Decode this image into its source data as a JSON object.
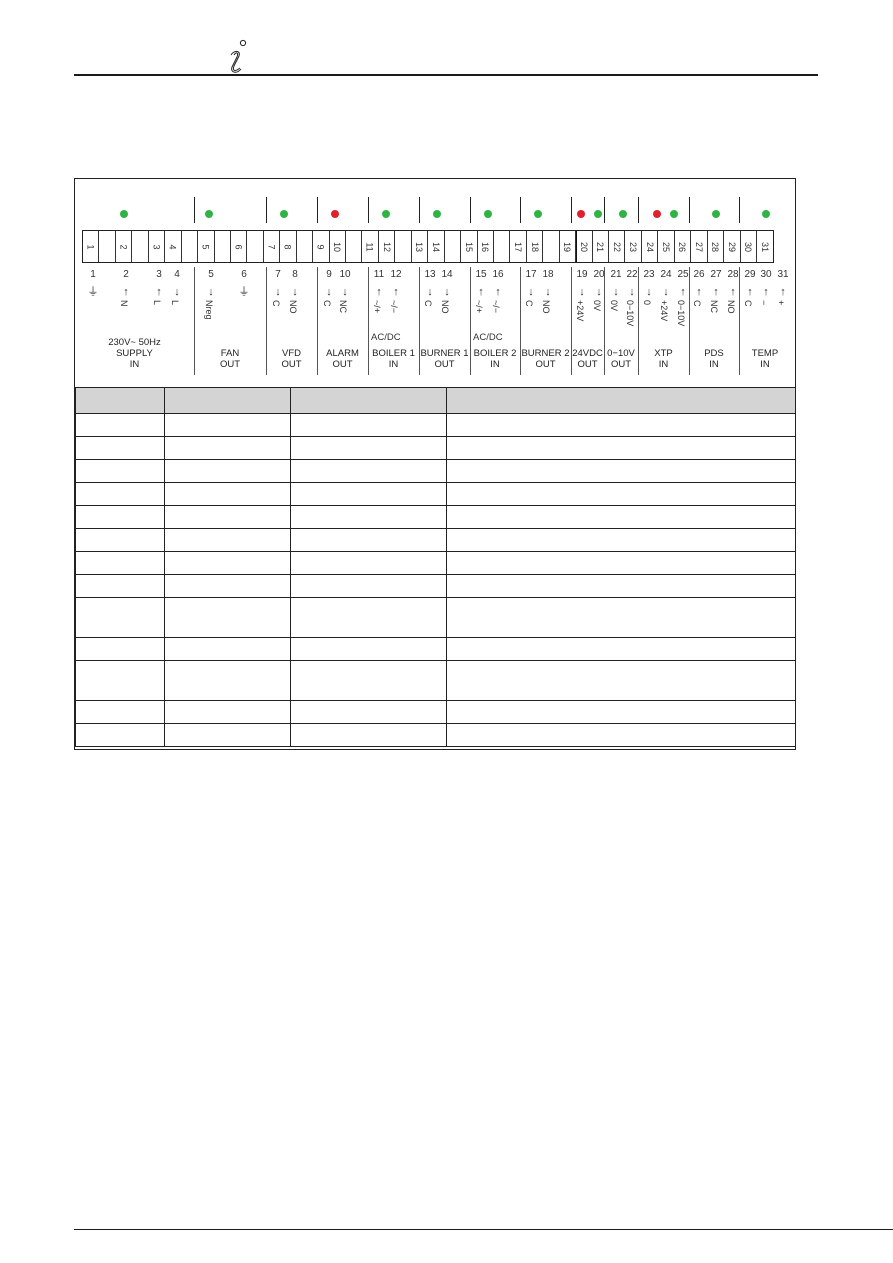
{
  "header": {
    "icon": "info-icon"
  },
  "diagram": {
    "strip_cells": [
      "1",
      "",
      "2",
      "",
      "3",
      "4",
      "",
      "5",
      "",
      "6",
      "",
      "7",
      "8",
      "",
      "9",
      "10",
      "",
      "11",
      "12",
      "",
      "13",
      "14",
      "",
      "15",
      "16",
      "",
      "17",
      "18",
      "",
      "19",
      "20",
      "21",
      "22",
      "23",
      "24",
      "25",
      "26",
      "27",
      "28",
      "29",
      "30",
      "31"
    ],
    "leds": [
      {
        "group": "supply",
        "color": "green"
      },
      {
        "group": "fan",
        "color": "green"
      },
      {
        "group": "vfd",
        "color": "green"
      },
      {
        "group": "alarm",
        "color": "red"
      },
      {
        "group": "boiler1",
        "color": "green"
      },
      {
        "group": "burner1",
        "color": "green"
      },
      {
        "group": "boiler2",
        "color": "green"
      },
      {
        "group": "burner2",
        "color": "green"
      },
      {
        "group": "24vdc",
        "color": "red"
      },
      {
        "group": "24vdc",
        "color": "green"
      },
      {
        "group": "0-10v",
        "color": "green"
      },
      {
        "group": "xtp",
        "color": "red"
      },
      {
        "group": "xtp",
        "color": "green"
      },
      {
        "group": "pds",
        "color": "green"
      },
      {
        "group": "temp",
        "color": "green"
      }
    ],
    "colors": {
      "led_green": "#2fb344",
      "led_red": "#e0202a"
    },
    "terminals": [
      {
        "n": "1",
        "arrow": "⏚",
        "sig": ""
      },
      {
        "n": "2",
        "arrow": "↑",
        "sig": "N"
      },
      {
        "n": "3",
        "arrow": "↑",
        "sig": "L"
      },
      {
        "n": "4",
        "arrow": "↓",
        "sig": "L"
      },
      {
        "n": "5",
        "arrow": "↓",
        "sig": "Nreg"
      },
      {
        "n": "6",
        "arrow": "⏚",
        "sig": ""
      },
      {
        "n": "7",
        "arrow": "↓",
        "sig": "C"
      },
      {
        "n": "8",
        "arrow": "↓",
        "sig": "NO"
      },
      {
        "n": "9",
        "arrow": "↓",
        "sig": "C"
      },
      {
        "n": "10",
        "arrow": "↓",
        "sig": "NC"
      },
      {
        "n": "11",
        "arrow": "↑",
        "sig": "~/+"
      },
      {
        "n": "12",
        "arrow": "↑",
        "sig": "~/−"
      },
      {
        "n": "13",
        "arrow": "↓",
        "sig": "C"
      },
      {
        "n": "14",
        "arrow": "↓",
        "sig": "NO"
      },
      {
        "n": "15",
        "arrow": "↑",
        "sig": "~/+"
      },
      {
        "n": "16",
        "arrow": "↑",
        "sig": "~/−"
      },
      {
        "n": "17",
        "arrow": "↓",
        "sig": "C"
      },
      {
        "n": "18",
        "arrow": "↓",
        "sig": "NO"
      },
      {
        "n": "19",
        "arrow": "↓",
        "sig": "+24V"
      },
      {
        "n": "20",
        "arrow": "↓",
        "sig": "0V"
      },
      {
        "n": "21",
        "arrow": "↓",
        "sig": "0V"
      },
      {
        "n": "22",
        "arrow": "↓",
        "sig": "0−10V"
      },
      {
        "n": "23",
        "arrow": "↓",
        "sig": "0"
      },
      {
        "n": "24",
        "arrow": "↓",
        "sig": "+24V"
      },
      {
        "n": "25",
        "arrow": "↑",
        "sig": "0−10V"
      },
      {
        "n": "26",
        "arrow": "↑",
        "sig": "C"
      },
      {
        "n": "27",
        "arrow": "↑",
        "sig": "NC"
      },
      {
        "n": "28",
        "arrow": "↑",
        "sig": "NO"
      },
      {
        "n": "29",
        "arrow": "↑",
        "sig": "C"
      },
      {
        "n": "30",
        "arrow": "↑",
        "sig": "−"
      },
      {
        "n": "31",
        "arrow": "↑",
        "sig": "+"
      }
    ],
    "acdc_label": "AC/DC",
    "groups": [
      {
        "id": "supply",
        "line1": "230V~ 50Hz",
        "line2": "SUPPLY",
        "line3": "IN"
      },
      {
        "id": "fan",
        "line1": "",
        "line2": "FAN",
        "line3": "OUT"
      },
      {
        "id": "vfd",
        "line1": "",
        "line2": "VFD",
        "line3": "OUT"
      },
      {
        "id": "alarm",
        "line1": "",
        "line2": "ALARM",
        "line3": "OUT"
      },
      {
        "id": "boiler1",
        "line1": "",
        "line2": "BOILER 1",
        "line3": "IN"
      },
      {
        "id": "burner1",
        "line1": "",
        "line2": "BURNER 1",
        "line3": "OUT"
      },
      {
        "id": "boiler2",
        "line1": "",
        "line2": "BOILER 2",
        "line3": "IN"
      },
      {
        "id": "burner2",
        "line1": "",
        "line2": "BURNER 2",
        "line3": "OUT"
      },
      {
        "id": "24vdc",
        "line1": "",
        "line2": "24VDC",
        "line3": "OUT"
      },
      {
        "id": "0-10v",
        "line1": "",
        "line2": "0−10V",
        "line3": "OUT"
      },
      {
        "id": "xtp",
        "line1": "",
        "line2": "XTP",
        "line3": "IN"
      },
      {
        "id": "pds",
        "line1": "",
        "line2": "PDS",
        "line3": "IN"
      },
      {
        "id": "temp",
        "line1": "",
        "line2": "TEMP",
        "line3": "IN"
      }
    ]
  },
  "table": {
    "headers": [
      "",
      "",
      "",
      ""
    ],
    "rows": [
      {
        "cells": [
          "",
          "",
          "",
          ""
        ],
        "tall": false
      },
      {
        "cells": [
          "",
          "",
          "",
          ""
        ],
        "tall": false
      },
      {
        "cells": [
          "",
          "",
          "",
          ""
        ],
        "tall": false
      },
      {
        "cells": [
          "",
          "",
          "",
          ""
        ],
        "tall": false
      },
      {
        "cells": [
          "",
          "",
          "",
          ""
        ],
        "tall": false
      },
      {
        "cells": [
          "",
          "",
          "",
          ""
        ],
        "tall": false
      },
      {
        "cells": [
          "",
          "",
          "",
          ""
        ],
        "tall": false
      },
      {
        "cells": [
          "",
          "",
          "",
          ""
        ],
        "tall": false
      },
      {
        "cells": [
          "",
          "",
          "",
          ""
        ],
        "tall": true
      },
      {
        "cells": [
          "",
          "",
          "",
          ""
        ],
        "tall": false
      },
      {
        "cells": [
          "",
          "",
          "",
          ""
        ],
        "tall": true
      },
      {
        "cells": [
          "",
          "",
          "",
          ""
        ],
        "tall": false
      },
      {
        "cells": [
          "",
          "",
          "",
          ""
        ],
        "tall": false
      }
    ]
  }
}
